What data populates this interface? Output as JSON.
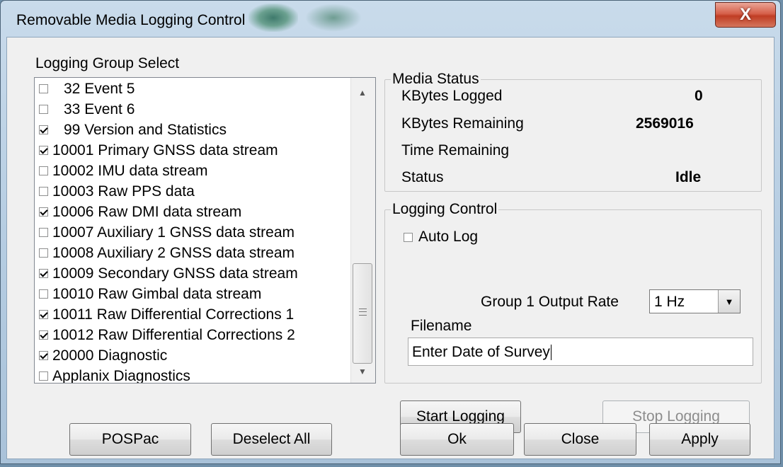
{
  "window": {
    "title": "Removable Media Logging Control",
    "close_glyph": "X"
  },
  "logging_group": {
    "label": "Logging Group Select",
    "items": [
      {
        "label": "32 Event 5",
        "checked": false
      },
      {
        "label": "33 Event 6",
        "checked": false
      },
      {
        "label": "99 Version and Statistics",
        "checked": true
      },
      {
        "label": "10001 Primary GNSS data stream",
        "checked": true
      },
      {
        "label": "10002 IMU data stream",
        "checked": false
      },
      {
        "label": "10003 Raw PPS data",
        "checked": false
      },
      {
        "label": "10006 Raw DMI data stream",
        "checked": true
      },
      {
        "label": "10007 Auxiliary 1 GNSS data stream",
        "checked": false
      },
      {
        "label": "10008 Auxiliary 2 GNSS data stream",
        "checked": false
      },
      {
        "label": "10009 Secondary GNSS data stream",
        "checked": true
      },
      {
        "label": "10010 Raw Gimbal data stream",
        "checked": false
      },
      {
        "label": "10011 Raw Differential Corrections 1",
        "checked": true
      },
      {
        "label": "10012 Raw Differential Corrections 2",
        "checked": true
      },
      {
        "label": "20000 Diagnostic",
        "checked": true
      },
      {
        "label": "Applanix Diagnostics",
        "checked": false
      }
    ]
  },
  "media_status": {
    "title": "Media Status",
    "kbytes_logged_label": "KBytes Logged",
    "kbytes_logged_value": "0",
    "kbytes_remaining_label": "KBytes Remaining",
    "kbytes_remaining_value": "2569016",
    "time_remaining_label": "Time Remaining",
    "time_remaining_value": "",
    "status_label": "Status",
    "status_value": "Idle"
  },
  "logging_control": {
    "title": "Logging Control",
    "auto_log_label": "Auto Log",
    "auto_log_checked": false,
    "output_rate_label": "Group 1 Output Rate",
    "output_rate_value": "1 Hz",
    "filename_label": "Filename",
    "filename_value": "Enter Date of Survey",
    "start_label": "Start Logging",
    "stop_label": "Stop Logging"
  },
  "buttons": {
    "pospac": "POSPac",
    "deselect_all": "Deselect All",
    "ok": "Ok",
    "close": "Close",
    "apply": "Apply"
  },
  "colors": {
    "window_bg": "#f0f0f0",
    "titlebar": "#b6cde2",
    "close_button": "#c7432a",
    "disabled_text": "#8d8d8d"
  }
}
